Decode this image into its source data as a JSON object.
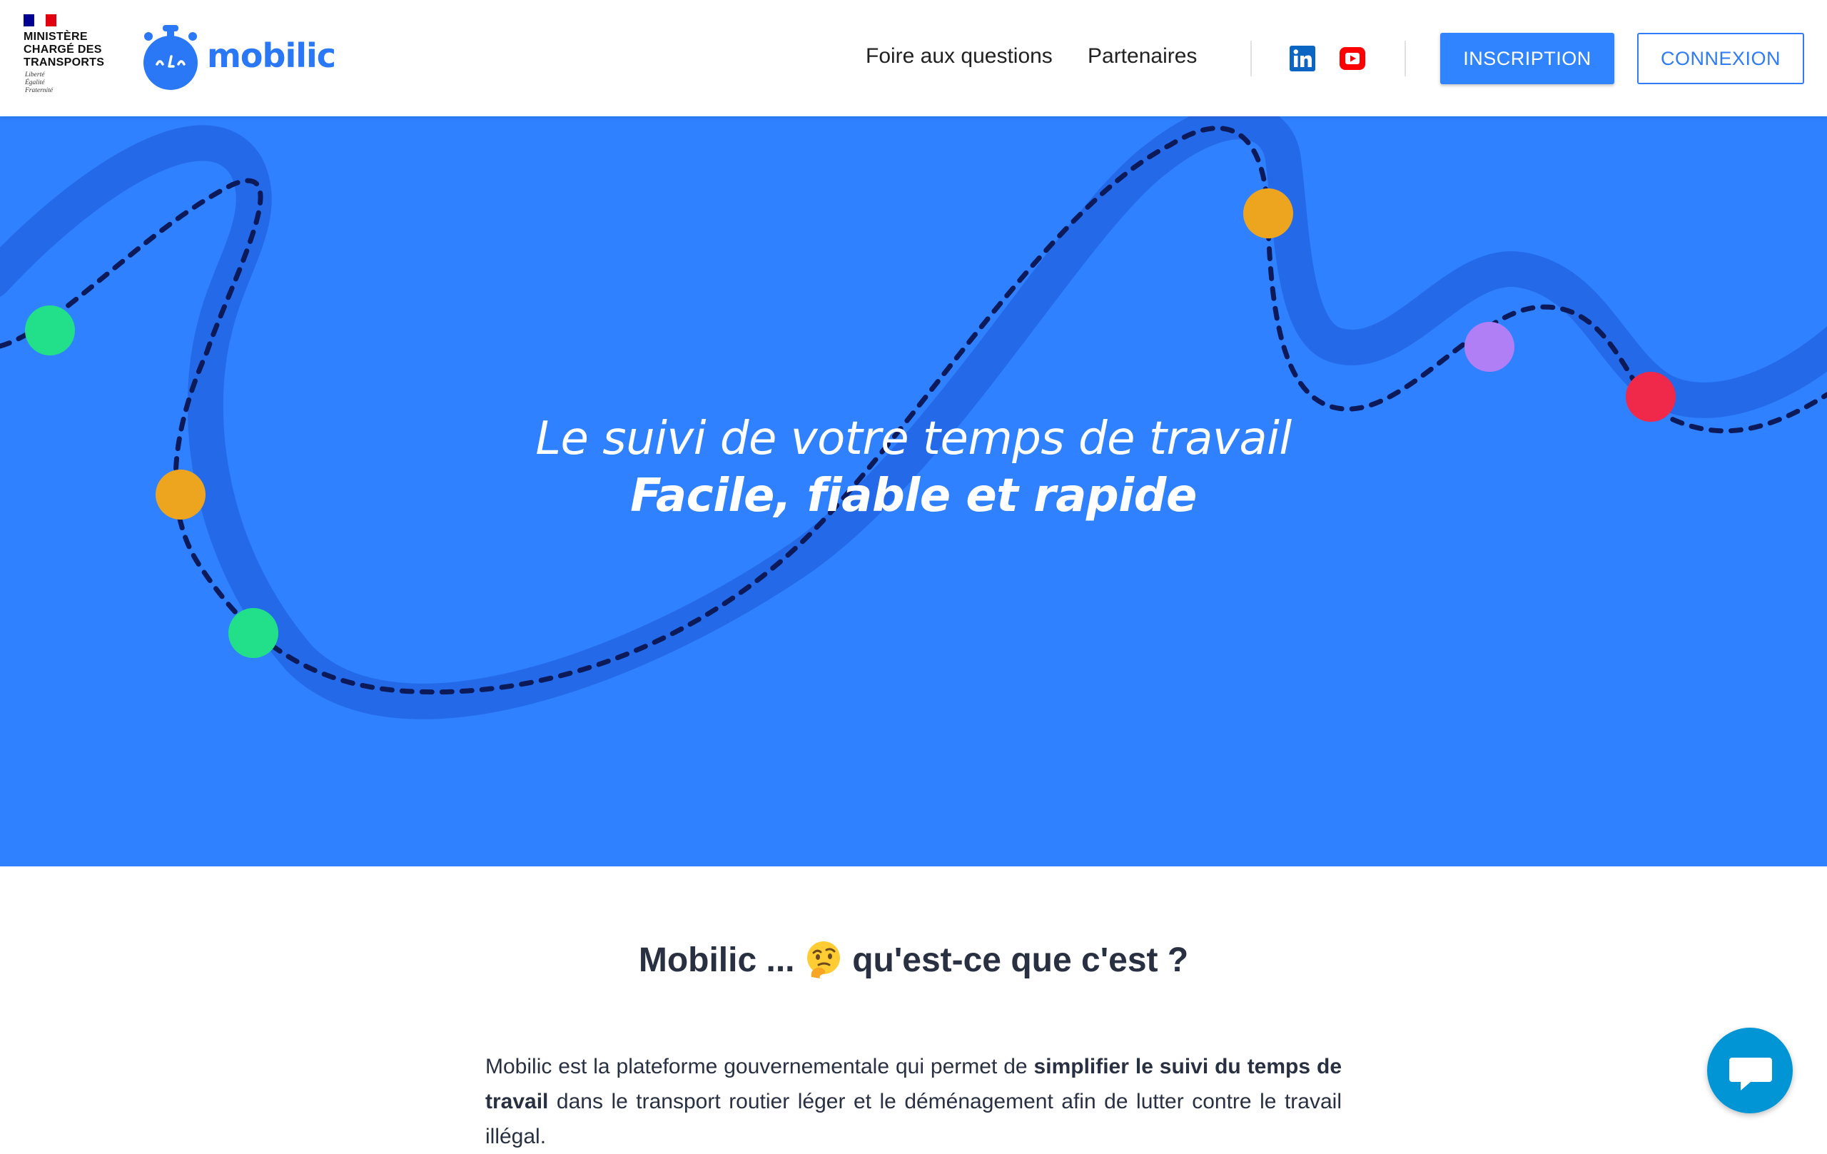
{
  "header": {
    "gov_logo": {
      "lines": [
        "MINISTÈRE",
        "CHARGÉ DES",
        "TRANSPORTS"
      ],
      "motto": [
        "Liberté",
        "Égalité",
        "Fraternité"
      ]
    },
    "brand": "mobilic",
    "nav": [
      "Foire aux questions",
      "Partenaires"
    ],
    "social": [
      "linkedin-icon",
      "youtube-icon"
    ],
    "signup_label": "INSCRIPTION",
    "login_label": "CONNEXION"
  },
  "hero": {
    "line1": "Le suivi de votre temps de travail",
    "line2": "Facile, fiable et rapide"
  },
  "section": {
    "title_part1": "Mobilic ... ",
    "title_emoji": "thinking-face-icon",
    "title_part2": " qu'est-ce que c'est ?",
    "para_part1": "Mobilic est la plateforme gouvernementale qui permet de ",
    "para_bold": "simplifier le suivi du temps de travail",
    "para_part2": " dans le transport routier léger et le déménagement afin de lutter contre le travail illégal."
  },
  "chat": {
    "icon": "chat-bubble-icon"
  },
  "colors": {
    "brand_blue": "#2f81ff",
    "button_blue": "#3184ff",
    "dot_green": "#22e08a",
    "dot_orange": "#eda51f",
    "dot_purple": "#b07ff6",
    "dot_red": "#f0284a",
    "text_dark": "#283041"
  }
}
